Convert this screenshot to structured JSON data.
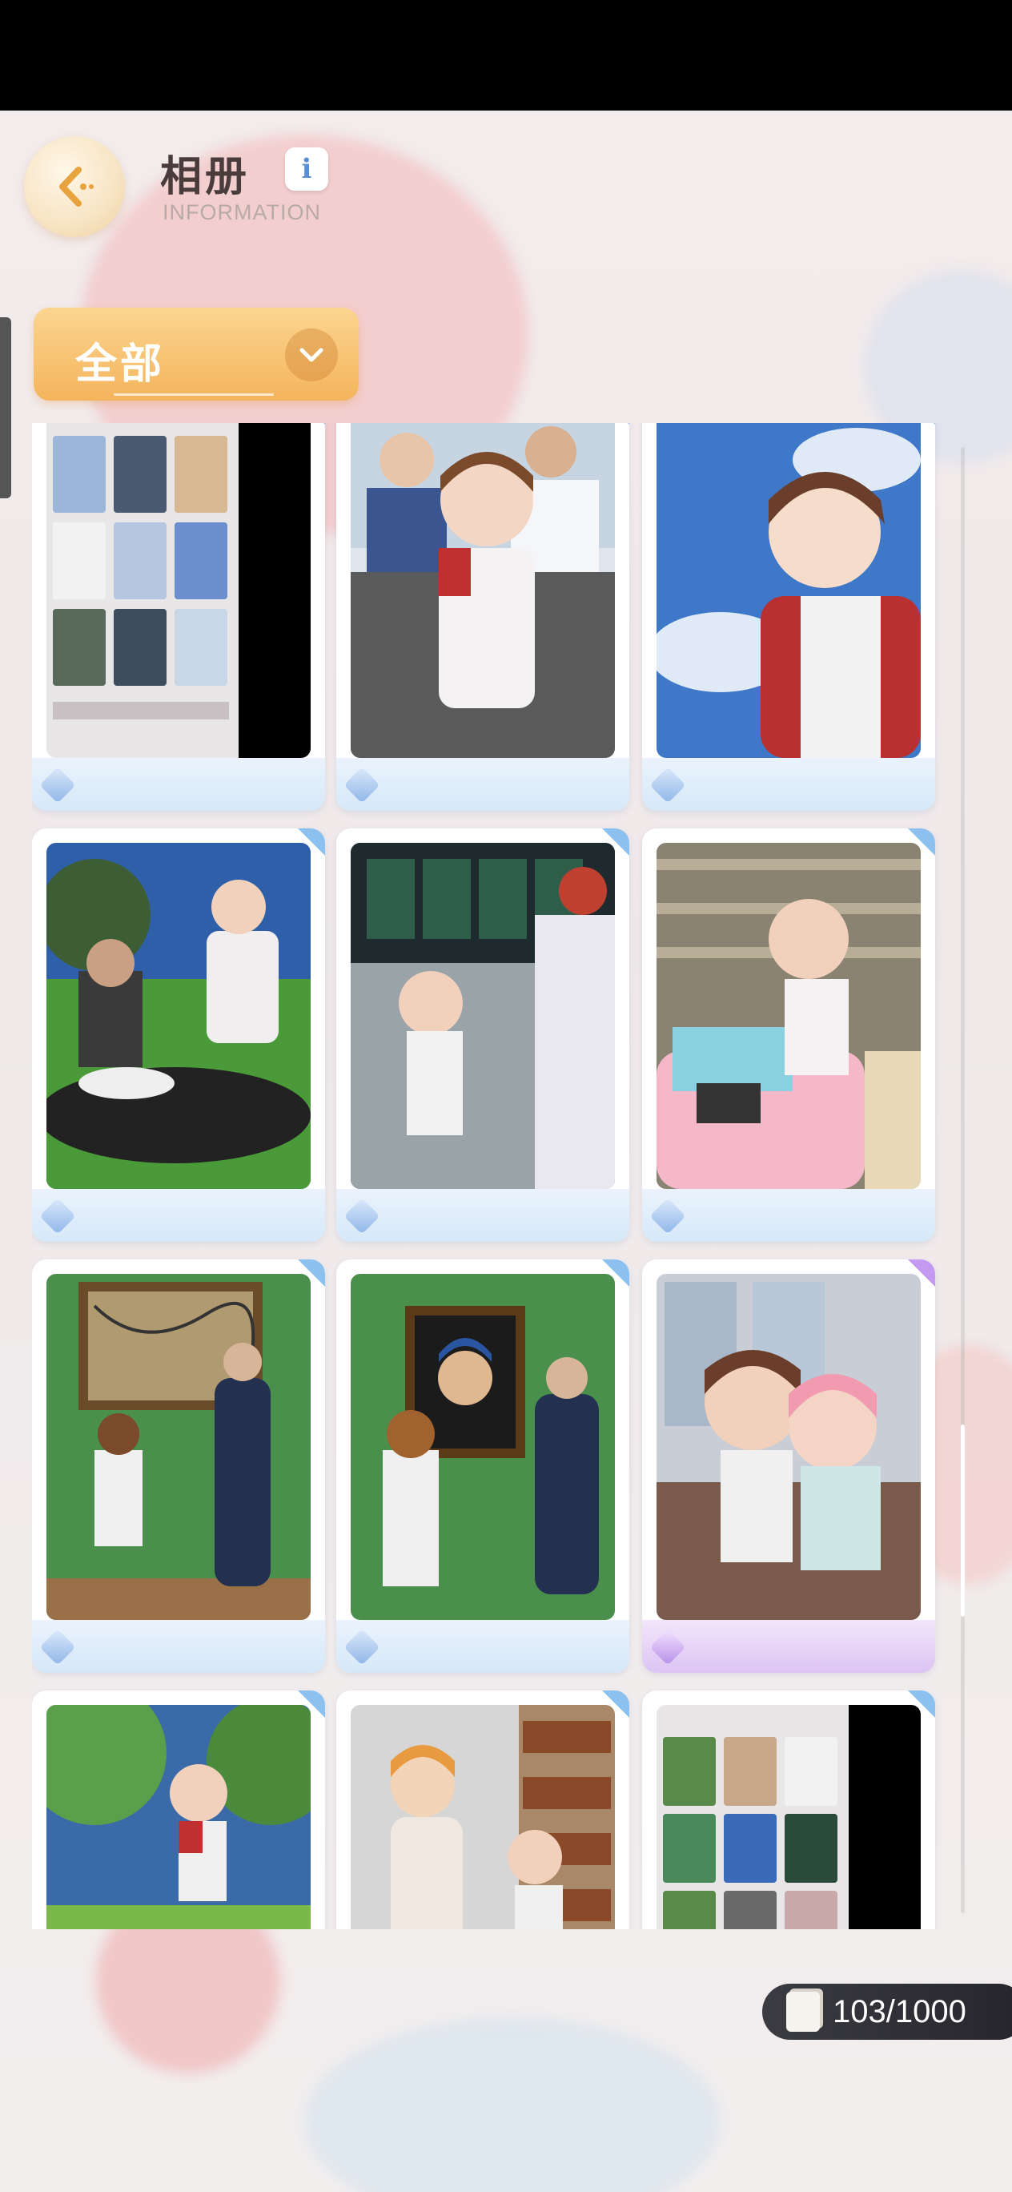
{
  "header": {
    "title": "相册",
    "subtitle": "INFORMATION",
    "info_icon": "i"
  },
  "filter": {
    "label": "全部"
  },
  "album": {
    "count": "103/1000",
    "photos": [
      {
        "name": "album-grid-screenshot",
        "scene": "grid",
        "frame": "blue"
      },
      {
        "name": "office-selfie",
        "scene": "office",
        "frame": "blue"
      },
      {
        "name": "sky-selfie",
        "scene": "sky",
        "frame": "blue"
      },
      {
        "name": "meadow-cow",
        "scene": "meadow",
        "frame": "blue"
      },
      {
        "name": "control-room",
        "scene": "control",
        "frame": "blue"
      },
      {
        "name": "shop-icecream-truck",
        "scene": "shop",
        "frame": "blue"
      },
      {
        "name": "gallery-abstract-painting",
        "scene": "museum1",
        "frame": "blue"
      },
      {
        "name": "gallery-pearl-earring",
        "scene": "museum2",
        "frame": "blue"
      },
      {
        "name": "train-friends",
        "scene": "train",
        "frame": "purple"
      },
      {
        "name": "forest-jump",
        "scene": "forest",
        "frame": "blue"
      },
      {
        "name": "library-friends",
        "scene": "library",
        "frame": "blue"
      },
      {
        "name": "album-grid-screenshot-2",
        "scene": "grid2",
        "frame": "blue"
      }
    ]
  },
  "colors": {
    "accent_orange": "#f4b45c",
    "frame_blue": "#8cc0ee",
    "frame_purple": "#c49af0"
  }
}
